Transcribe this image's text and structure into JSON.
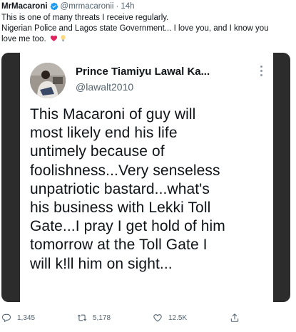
{
  "author": {
    "display_name": "MrMacaroni",
    "handle": "@mrmacaronii",
    "separator": "·",
    "time": "14h",
    "verified_icon": "verified-badge-icon"
  },
  "tweet_text": {
    "line1": "This is one of many threats I receive regularly.",
    "line2": "Nigerian Police and Lagos state Government... I love you, and I know you",
    "line3": "love me too.",
    "emojis": [
      "heart-emoji",
      "lightbulb-emoji"
    ]
  },
  "quoted": {
    "display_name": "Prince Tiamiyu Lawal Ka...",
    "handle": "@lawalt2010",
    "more_icon": "more-options-icon",
    "lines": [
      "This Macaroni of guy will",
      "most likely end his life",
      "untimely because of",
      "foolishness...Very senseless",
      "unpatriotic bastard...what's",
      "his business with Lekki Toll",
      "Gate...I pray I get hold of him",
      "tomorrow at the Toll Gate I",
      "will k!ll him on sight..."
    ]
  },
  "actions": {
    "reply_count": "1,345",
    "retweet_count": "5,178",
    "like_count": "12.5K",
    "icons": [
      "reply-icon",
      "retweet-icon",
      "like-icon",
      "share-icon"
    ]
  },
  "colors": {
    "text": "#0f1419",
    "secondary": "#536471",
    "verified": "#1d9bf0",
    "media_bg": "#2c2c2c",
    "heart": "#e0245e"
  }
}
